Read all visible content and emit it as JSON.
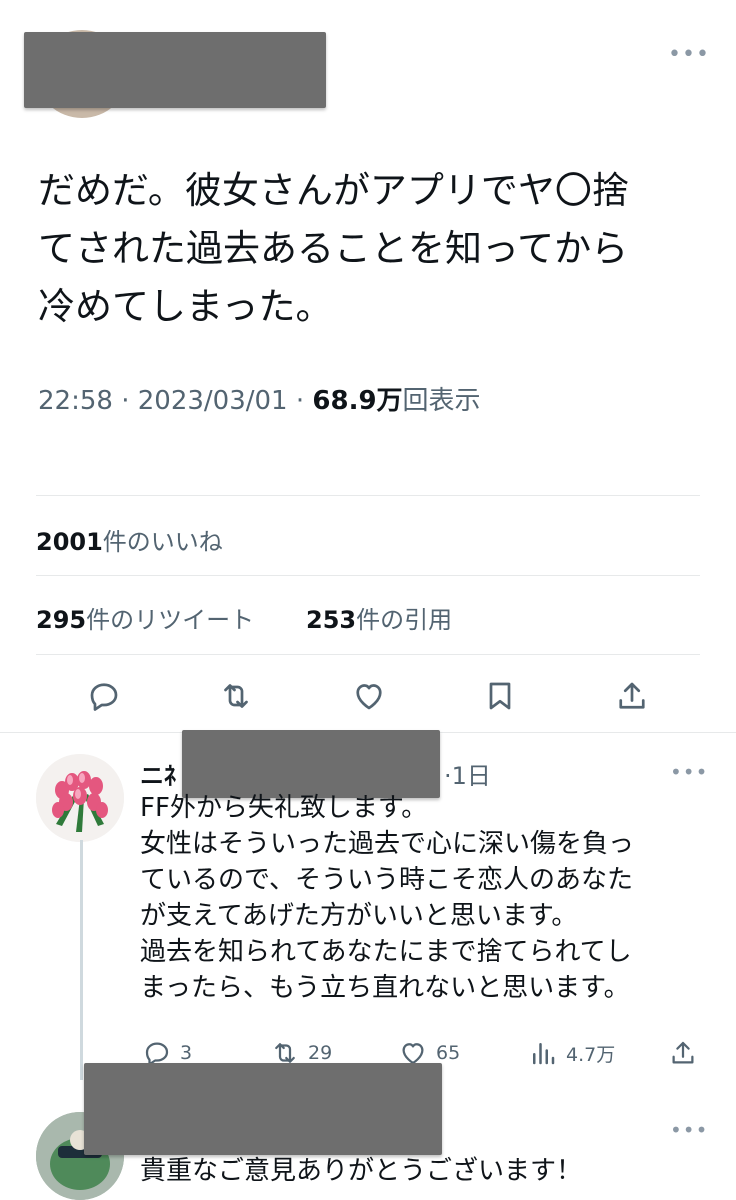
{
  "tweet": {
    "text_lines": [
      "だめだ。彼女さんがアプリでヤ〇捨",
      "てされた過去あることを知ってから",
      "冷めてしまった。"
    ],
    "time": "22:58",
    "date": "2023/03/01",
    "views_count": "68.9万",
    "views_label": "回表示",
    "likes_count": "2001",
    "likes_label": "件のいいね",
    "retweets_count": "295",
    "retweets_label": "件のリツイート",
    "quotes_count": "253",
    "quotes_label": "件の引用",
    "more_glyph": "•••"
  },
  "reply": {
    "name_visible": "ニﾈ",
    "time": "·1日",
    "text_lines": [
      "FF外から失礼致します。",
      "女性はそういった過去で心に深い傷を負っ",
      "ているので、そういう時こそ恋人のあなた",
      "が支えてあげた方がいいと思います。",
      "過去を知られてあなたにまで捨てられてし",
      "まったら、もう立ち直れないと思います。"
    ],
    "replies": "3",
    "retweets": "29",
    "likes": "65",
    "views": "4.7万"
  },
  "next_reply": {
    "text": "貴重なご意見ありがとうございます！"
  },
  "icons": [
    "reply-icon",
    "retweet-icon",
    "like-icon",
    "bookmark-icon",
    "share-icon",
    "analytics-icon",
    "more-icon"
  ],
  "colors": {
    "text": "#0f1419",
    "secondary": "#536471",
    "divider": "#e7e9ea",
    "redaction": "#6e6e6e"
  }
}
